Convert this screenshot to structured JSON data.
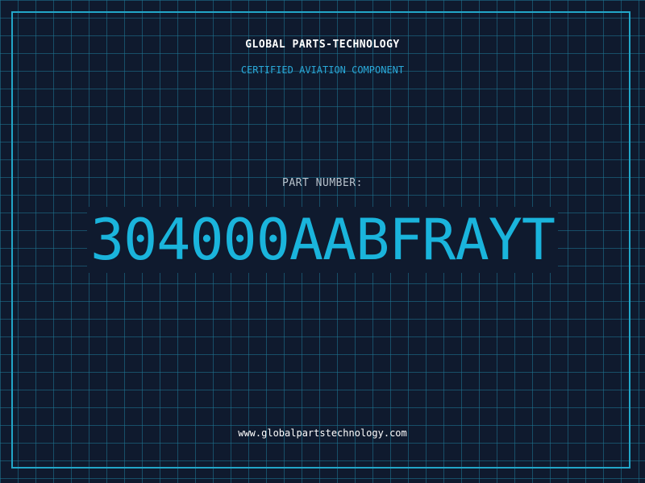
{
  "header": {
    "company": "GLOBAL PARTS-TECHNOLOGY",
    "tagline": "CERTIFIED AVIATION COMPONENT"
  },
  "part": {
    "label": "PART NUMBER:",
    "number": "304000AABFRAYT"
  },
  "footer": {
    "website": "www.globalpartstechnology.com"
  },
  "colors": {
    "background": "#0f1a2e",
    "grid": "#1e7896",
    "frame": "#22a6c8",
    "accent": "#1ab4dc",
    "label": "#b8c2cc",
    "text": "#ffffff"
  }
}
